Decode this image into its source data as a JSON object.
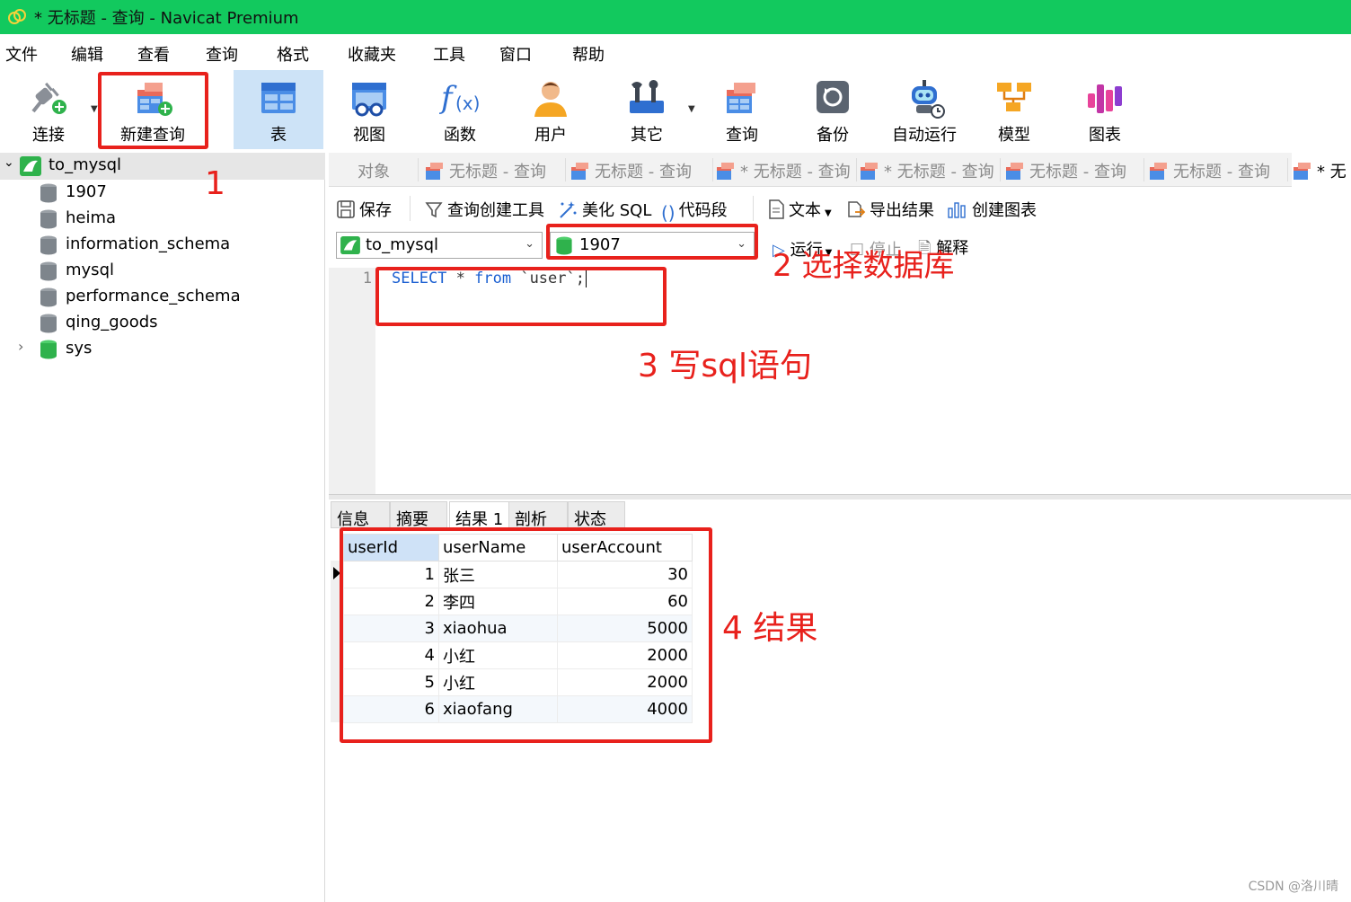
{
  "window": {
    "title": "* 无标题 - 查询 - Navicat Premium"
  },
  "menu": [
    "文件",
    "编辑",
    "查看",
    "查询",
    "格式",
    "收藏夹",
    "工具",
    "窗口",
    "帮助"
  ],
  "toolbar": {
    "connect": "连接",
    "new_query": "新建查询",
    "table": "表",
    "view": "视图",
    "function": "函数",
    "user": "用户",
    "other": "其它",
    "query": "查询",
    "backup": "备份",
    "auto_run": "自动运行",
    "model": "模型",
    "chart": "图表"
  },
  "tree": {
    "connection": "to_mysql",
    "databases": [
      "1907",
      "heima",
      "information_schema",
      "mysql",
      "performance_schema",
      "qing_goods",
      "sys"
    ]
  },
  "tabs": {
    "objects": "对象",
    "items": [
      "无标题 - 查询",
      "无标题 - 查询",
      "* 无标题 - 查询",
      "* 无标题 - 查询",
      "无标题 - 查询",
      "无标题 - 查询",
      "* 无"
    ]
  },
  "query_toolbar": {
    "save": "保存",
    "builder": "查询创建工具",
    "beautify": "美化 SQL",
    "snippet": "代码段",
    "text": "文本",
    "export": "导出结果",
    "create_chart": "创建图表"
  },
  "selectors": {
    "connection": "to_mysql",
    "database": "1907",
    "run": "运行",
    "stop": "停止",
    "explain": "解释"
  },
  "editor": {
    "line_number": "1",
    "sql_select": "SELECT",
    "sql_star": " * ",
    "sql_from": "from",
    "sql_rest": " `user`;"
  },
  "result_tabs": [
    "信息",
    "摘要",
    "结果 1",
    "剖析",
    "状态"
  ],
  "result": {
    "columns": [
      "userId",
      "userName",
      "userAccount"
    ],
    "rows": [
      [
        "1",
        "张三",
        "30"
      ],
      [
        "2",
        "李四",
        "60"
      ],
      [
        "3",
        "xiaohua",
        "5000"
      ],
      [
        "4",
        "小红",
        "2000"
      ],
      [
        "5",
        "小红",
        "2000"
      ],
      [
        "6",
        "xiaofang",
        "4000"
      ]
    ]
  },
  "annotations": {
    "step1": "1",
    "step2": "2 选择数据库",
    "step3": "3 写sql语句",
    "step4": "4 结果"
  },
  "colors": {
    "titlebar": "#12c95e",
    "annotation": "#e8211c",
    "keyword": "#1a5fd1"
  },
  "watermark": "CSDN @洛川晴"
}
